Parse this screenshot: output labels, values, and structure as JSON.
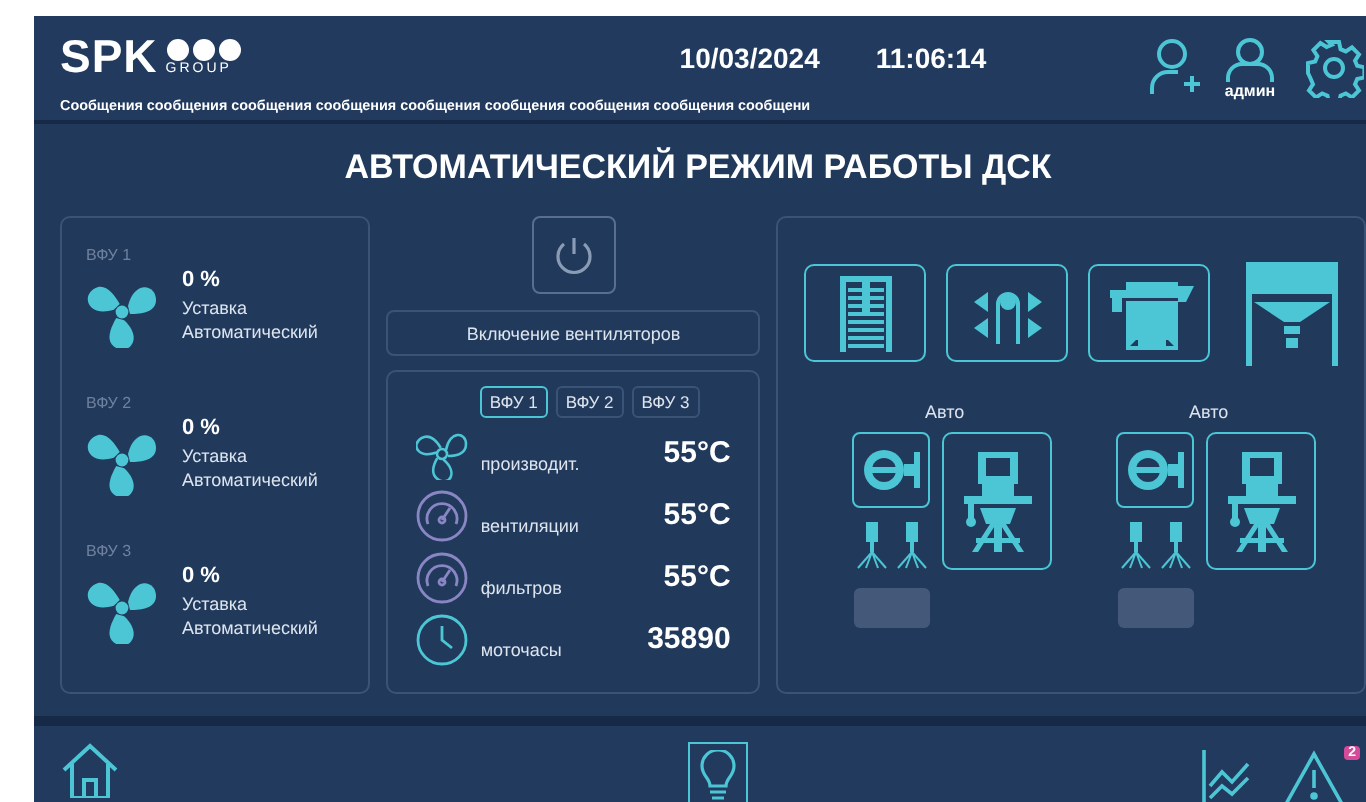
{
  "header": {
    "logo": "SPK",
    "logo_sub": "GROUP",
    "messages": "Сообщения сообщения сообщения сообщения сообщения сообщения сообщения сообщения сообщени",
    "date": "10/03/2024",
    "time": "11:06:14",
    "user": "админ"
  },
  "title": "АВТОМАТИЧЕСКИЙ РЕЖИМ РАБОТЫ ДСК",
  "fans": [
    {
      "label": "ВФУ 1",
      "percent": "0 %",
      "setpoint": "Уставка",
      "mode": "Автоматический"
    },
    {
      "label": "ВФУ 2",
      "percent": "0 %",
      "setpoint": "Уставка",
      "mode": "Автоматический"
    },
    {
      "label": "ВФУ 3",
      "percent": "0 %",
      "setpoint": "Уставка",
      "mode": "Автоматический"
    }
  ],
  "fan_switch": {
    "label": "Включение вентиляторов"
  },
  "tabs": [
    {
      "label": "ВФУ 1",
      "selected": true
    },
    {
      "label": "ВФУ 2",
      "selected": false
    },
    {
      "label": "ВФУ 3",
      "selected": false
    }
  ],
  "readings": [
    {
      "kind": "fan",
      "label": "производит.",
      "value": "55°C"
    },
    {
      "kind": "gauge",
      "label": "вентиляции",
      "value": "55°C"
    },
    {
      "kind": "gauge",
      "label": "фильтров",
      "value": "55°C"
    },
    {
      "kind": "clock",
      "label": "моточасы",
      "value": "35890"
    }
  ],
  "equipment": [
    {
      "kind": "cabinet",
      "selected": true
    },
    {
      "kind": "conveyor",
      "selected": true
    },
    {
      "kind": "mixer",
      "selected": true
    },
    {
      "kind": "hopper",
      "selected": false
    }
  ],
  "units": [
    {
      "mode": "Авто"
    },
    {
      "mode": "Авто"
    }
  ],
  "footer": {
    "alerts": "2"
  }
}
